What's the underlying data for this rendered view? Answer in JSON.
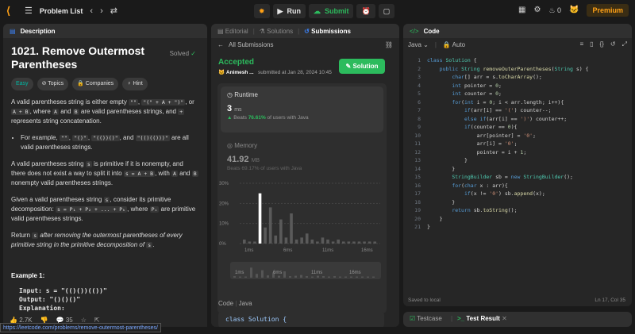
{
  "topbar": {
    "title": "Problem List",
    "run": "Run",
    "submit": "Submit",
    "count": "0",
    "premium": "Premium"
  },
  "desc": {
    "tab": "Description",
    "tab2": "Editorial",
    "tab3": "Solutions",
    "tab4": "Submissions",
    "title": "1021. Remove Outermost Parentheses",
    "solved": "Solved",
    "tags": [
      "Easy",
      "Topics",
      "Companies",
      "Hint"
    ],
    "p1a": "A valid parentheses string is either empty ",
    "p1code1": "\"\"",
    "p1b": ", ",
    "p1code2": "\"(\" + A + \")\"",
    "p1c": ", or ",
    "p1code3": "A + B",
    "p1d": ", where ",
    "p1code4": "A",
    "p1e": " and ",
    "p1code5": "B",
    "p1f": " are valid parentheses strings, and ",
    "p1code6": "+",
    "p1g": " represents string concatenation.",
    "li_a": "For example, ",
    "li_c1": "\"\"",
    "li_b": ", ",
    "li_c2": "\"()\"",
    "li_c": ", ",
    "li_c3": "\"(())()\"",
    "li_d": ", and ",
    "li_c4": "\"(()(()))\"",
    "li_e": " are all valid parentheses strings.",
    "p2a": "A valid parentheses string ",
    "p2c1": "s",
    "p2b": " is primitive if it is nonempty, and there does not exist a way to split it into ",
    "p2c2": "s = A + B",
    "p2c": ", with ",
    "p2c3": "A",
    "p2d": " and ",
    "p2c4": "B",
    "p2e": " nonempty valid parentheses strings.",
    "p3a": "Given a valid parentheses string ",
    "p3c1": "s",
    "p3b": ", consider its primitive decomposition: ",
    "p3c2": "s = P₁ + P₂ + ... + Pₖ",
    "p3c": ", where ",
    "p3c3": "Pᵢ",
    "p3d": " are primitive valid parentheses strings.",
    "p4a": "Return ",
    "p4c1": "s",
    "p4b": " after removing the outermost parentheses of every primitive string in the primitive decomposition of ",
    "p4c2": "s",
    "p4c": ".",
    "ex": "Example 1:",
    "in": "Input: s = \"(()())(())\"",
    "out": "Output: \"()()()\"",
    "expl": "Explanation:",
    "likes": "2.7K",
    "comments": "35"
  },
  "url": "https://leetcode.com/problems/remove-outermost-parentheses/",
  "subs": {
    "back": "All Submissions",
    "status": "Accepted",
    "author": "Animesh ...",
    "date": "submitted at Jan 28, 2024 10:45",
    "solution": "Solution",
    "runtime_label": "Runtime",
    "runtime": "3",
    "runtime_unit": "ms",
    "beats_a": "Beats ",
    "beats_pct": "76.61%",
    "beats_b": " of users with Java",
    "memory_label": "Memory",
    "memory": "41.92",
    "memory_unit": "MB",
    "mbeats": "Beats 69.17% of users with Java",
    "code_label": "Code",
    "lang": "Java",
    "snip": "class Solution {"
  },
  "chart_data": {
    "type": "bar",
    "yticks": [
      "30%",
      "20%",
      "10%",
      "0%"
    ],
    "xticks": [
      "1ms",
      "6ms",
      "11ms",
      "16ms"
    ],
    "ylim": [
      0,
      30
    ],
    "values": [
      2,
      1,
      1,
      25,
      8,
      18,
      4,
      12,
      3,
      15,
      2,
      3,
      5,
      2,
      1,
      3,
      2,
      1,
      2,
      1,
      1,
      1,
      1,
      1,
      1,
      1
    ],
    "highlight_index": 3
  },
  "editor": {
    "tab": "Code",
    "lang": "Java",
    "mode": "Auto",
    "saved": "Saved to local",
    "pos": "Ln 17, Col 35",
    "lines": [
      "class Solution {",
      "    public String removeOuterParentheses(String s) {",
      "        char[] arr = s.toCharArray();",
      "        int pointer = 0;",
      "        int counter = 0;",
      "        for(int i = 0; i < arr.length; i++){",
      "            if(arr[i] == '(') counter--;",
      "            else if(arr[i] == ')') counter++;",
      "            if(counter == 0){",
      "                arr[pointer] = '0';",
      "                arr[i] = '0';",
      "                pointer = i + 1;",
      "            }",
      "        }",
      "        StringBuilder sb = new StringBuilder();",
      "        for(char x : arr){",
      "            if(x != '0') sb.append(x);",
      "        }",
      "        return sb.toString();",
      "    }",
      "}"
    ]
  },
  "test": {
    "tab1": "Testcase",
    "tab2": "Test Result"
  }
}
